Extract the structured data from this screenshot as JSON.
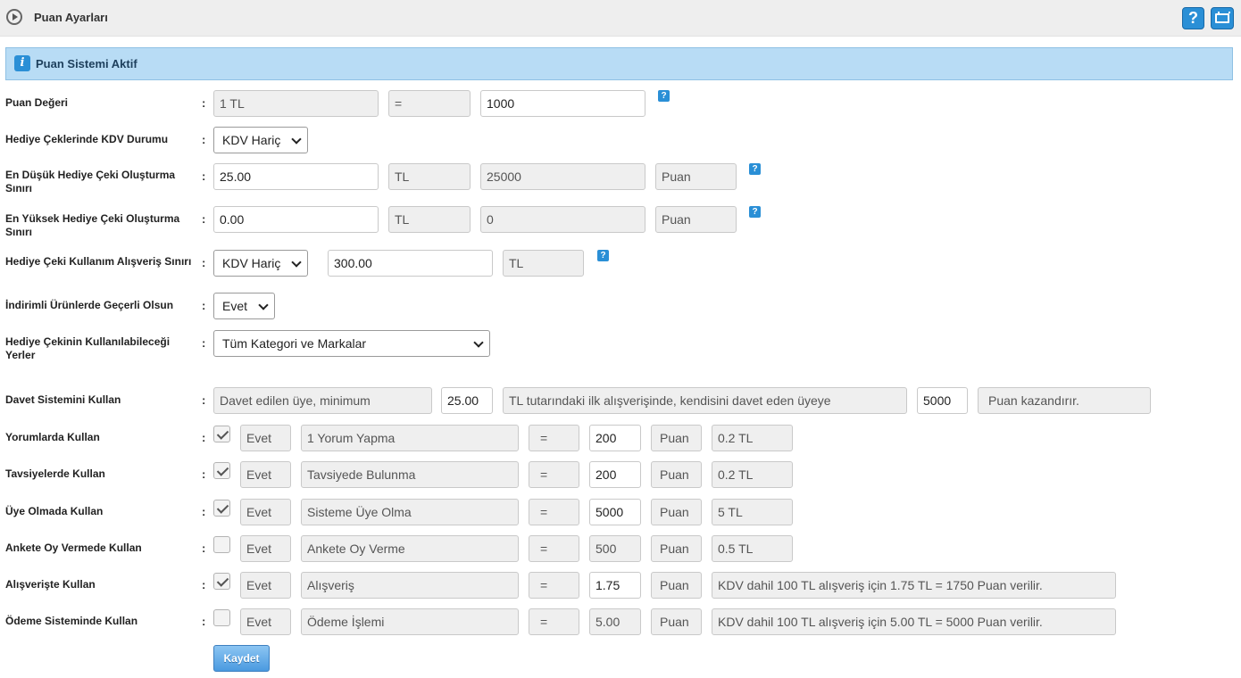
{
  "header": {
    "title": "Puan Ayarları",
    "help_label": "?"
  },
  "info": {
    "icon": "i",
    "text": "Puan Sistemi Aktif"
  },
  "colon": ":",
  "help_mark": "?",
  "puan_degeri": {
    "label": "Puan Değeri",
    "left": "1 TL",
    "eq": "=",
    "value": "1000"
  },
  "kdv": {
    "label": "Hediye Çeklerinde KDV Durumu",
    "selected": "KDV Hariç"
  },
  "min_limit": {
    "label": "En Düşük Hediye Çeki Oluşturma Sınırı",
    "value": "25.00",
    "unit": "TL",
    "points": "25000",
    "points_unit": "Puan"
  },
  "max_limit": {
    "label": "En Yüksek Hediye Çeki Oluşturma Sınırı",
    "value": "0.00",
    "unit": "TL",
    "points": "0",
    "points_unit": "Puan"
  },
  "usage_limit": {
    "label": "Hediye Çeki Kullanım Alışveriş Sınırı",
    "selected": "KDV Hariç",
    "value": "300.00",
    "unit": "TL"
  },
  "discounted": {
    "label": "İndirimli Ürünlerde Geçerli Olsun",
    "selected": "Evet"
  },
  "usable_places": {
    "label": "Hediye Çekinin Kullanılabileceği Yerler",
    "selected": "Tüm Kategori ve Markalar"
  },
  "invite": {
    "label": "Davet Sistemini Kullan",
    "text1": "Davet edilen üye, minimum",
    "amount": "25.00",
    "text2": "TL tutarındaki ilk alışverişinde, kendisini davet eden üyeye",
    "points": "5000",
    "text3": "Puan kazandırır."
  },
  "rules": [
    {
      "label": "Yorumlarda Kullan",
      "checked": true,
      "status": "Evet",
      "action": "1 Yorum Yapma",
      "eq": "=",
      "value": "200",
      "unit": "Puan",
      "result": "0.2 TL"
    },
    {
      "label": "Tavsiyelerde Kullan",
      "checked": true,
      "status": "Evet",
      "action": "Tavsiyede Bulunma",
      "eq": "=",
      "value": "200",
      "unit": "Puan",
      "result": "0.2 TL"
    },
    {
      "label": "Üye Olmada Kullan",
      "checked": true,
      "status": "Evet",
      "action": "Sisteme Üye Olma",
      "eq": "=",
      "value": "5000",
      "unit": "Puan",
      "result": "5 TL"
    },
    {
      "label": "Ankete Oy Vermede Kullan",
      "checked": false,
      "status": "Evet",
      "action": "Ankete Oy Verme",
      "eq": "=",
      "value": "500",
      "unit": "Puan",
      "result": "0.5 TL"
    },
    {
      "label": "Alışverişte Kullan",
      "checked": true,
      "status": "Evet",
      "action": "Alışveriş",
      "eq": "=",
      "value": "1.75",
      "unit": "Puan",
      "result": "KDV dahil 100 TL alışveriş için 1.75 TL = 1750 Puan verilir."
    },
    {
      "label": "Ödeme Sisteminde Kullan",
      "checked": false,
      "status": "Evet",
      "action": "Ödeme İşlemi",
      "eq": "=",
      "value": "5.00",
      "unit": "Puan",
      "result": "KDV dahil 100 TL alışveriş için 5.00 TL = 5000 Puan verilir."
    }
  ],
  "save_label": "Kaydet"
}
